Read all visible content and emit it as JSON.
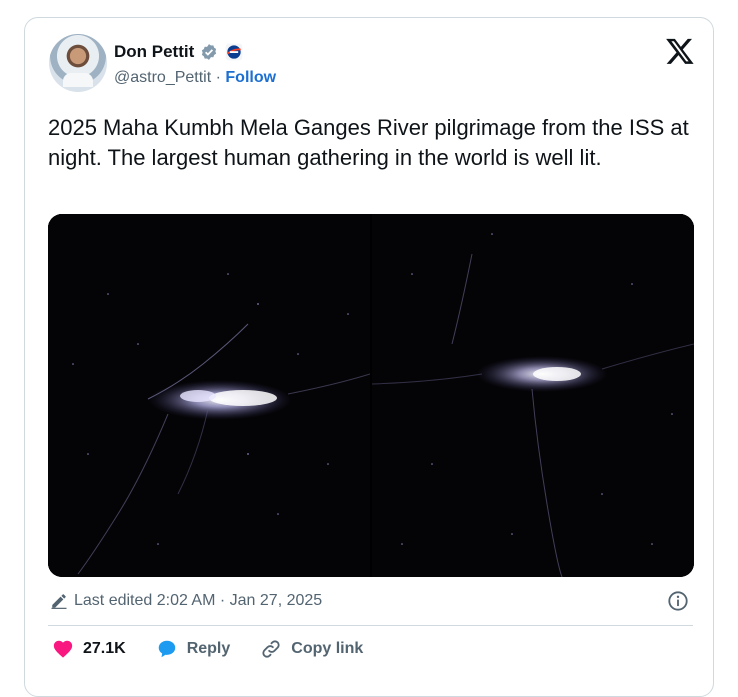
{
  "author": {
    "name": "Don Pettit",
    "handle": "@astro_Pettit",
    "separator": "·",
    "follow_label": "Follow",
    "verified_color": "#829aab",
    "follow_color": "#1d6fd1"
  },
  "tweet": {
    "text": "2025 Maha Kumbh Mela Ganges River pilgrimage from the ISS at night. The largest human gathering in the world is well lit."
  },
  "meta": {
    "edited_label": "Last edited 2:02 AM · Jan 27, 2025"
  },
  "actions": {
    "likes": "27.1K",
    "reply_label": "Reply",
    "copy_label": "Copy link",
    "like_color": "#f91880",
    "reply_color": "#1d9bf0"
  },
  "icons": [
    "verified-badge-icon",
    "nasa-logo-icon",
    "x-logo-icon",
    "pencil-icon",
    "info-icon",
    "heart-icon",
    "reply-bubble-icon",
    "link-icon"
  ]
}
